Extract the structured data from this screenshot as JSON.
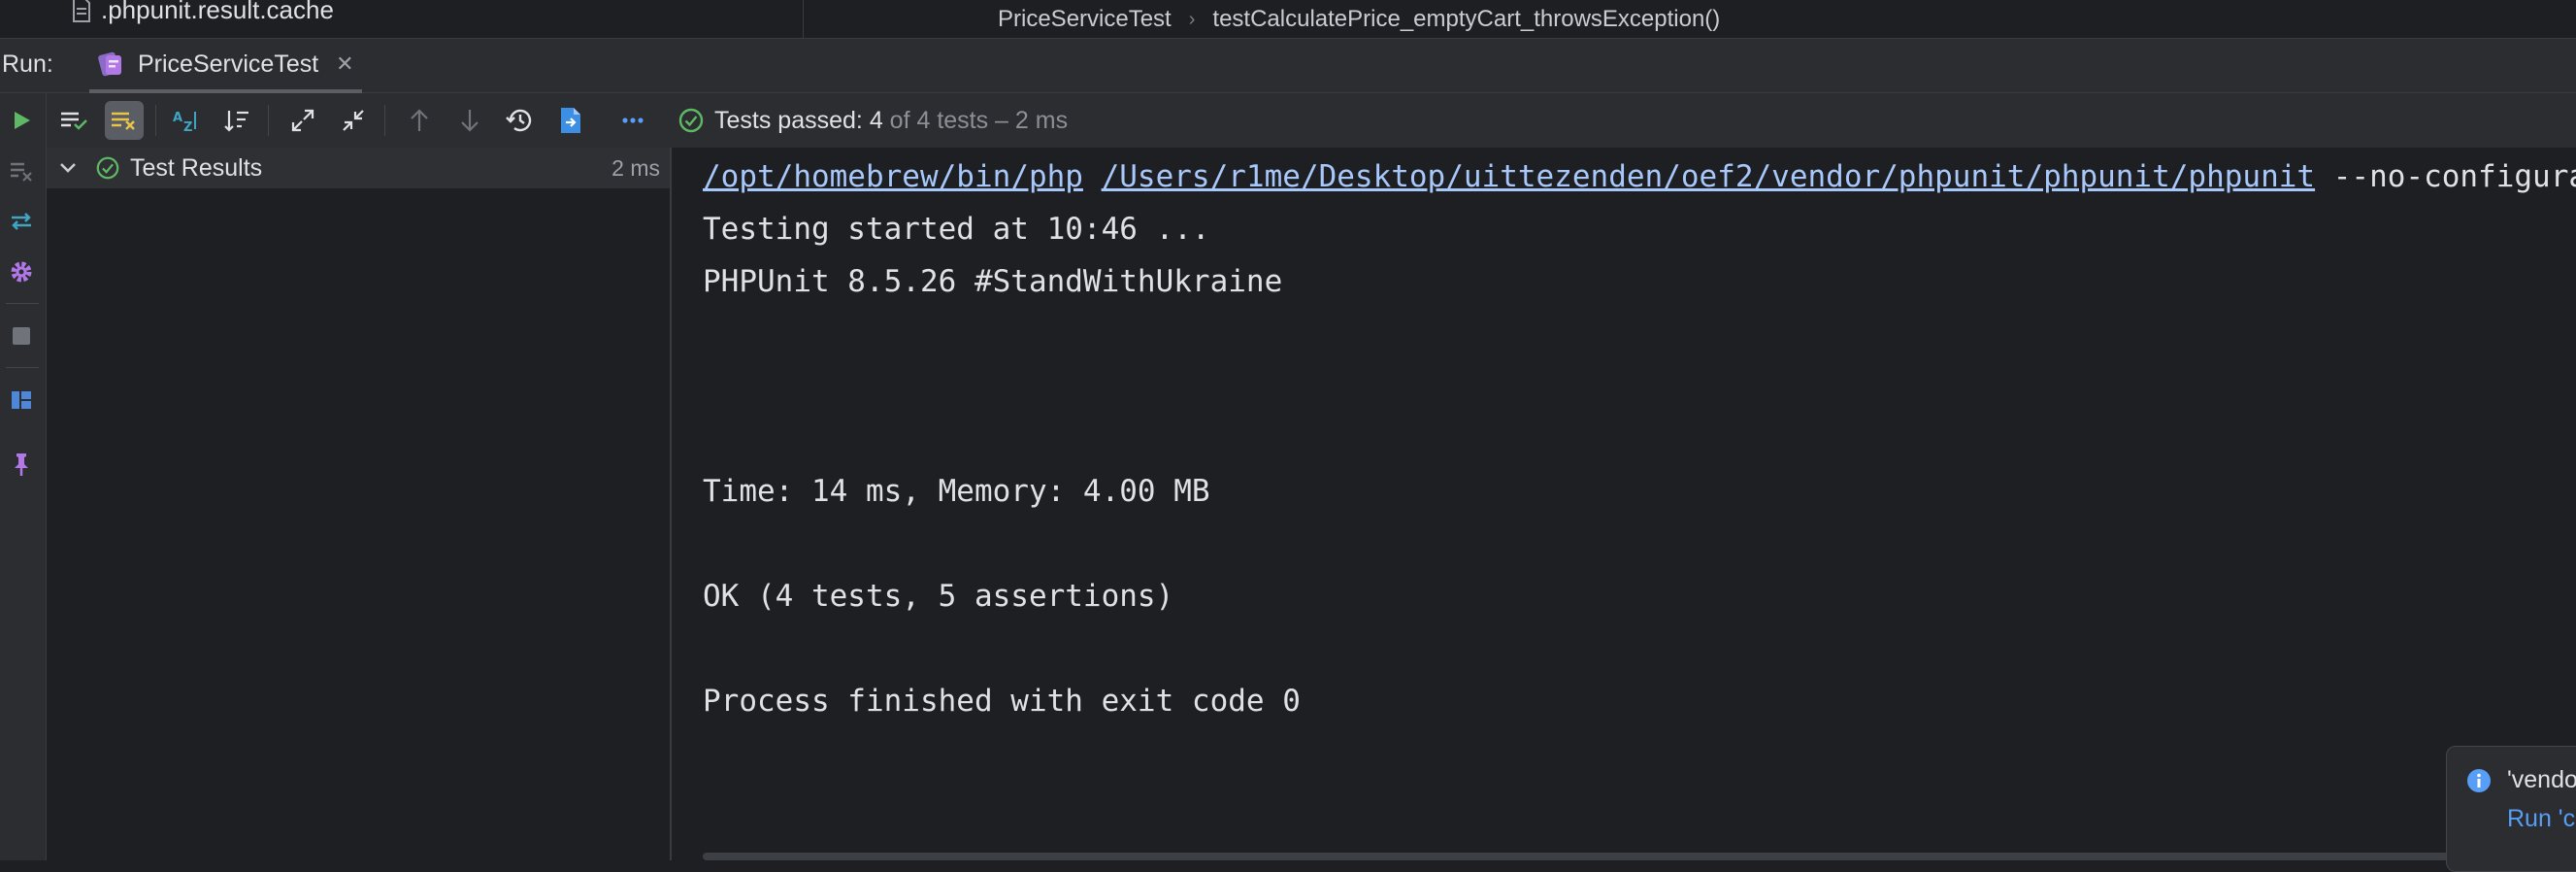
{
  "project": {
    "file_name": ".phpunit.result.cache"
  },
  "breadcrumb": {
    "class_name": "PriceServiceTest",
    "method_name": "testCalculatePrice_emptyCart_throwsException()"
  },
  "run_bar": {
    "label": "Run:",
    "tab_title": "PriceServiceTest"
  },
  "test_status": {
    "passed_label": "Tests passed:",
    "passed_count": "4",
    "of_total": "of 4 tests – 2 ms"
  },
  "tree": {
    "root_label": "Test Results",
    "root_duration": "2 ms"
  },
  "console": {
    "php_path": "/opt/homebrew/bin/php",
    "phpunit_path": "/Users/r1me/Desktop/uittezenden/oef2/vendor/phpunit/phpunit/phpunit",
    "args": "--no-configuration",
    "lines": {
      "started": "Testing started at 10:46 ...",
      "version": "PHPUnit 8.5.26 #StandWithUkraine",
      "time": "Time: 14 ms, Memory: 4.00 MB",
      "ok": "OK (4 tests, 5 assertions)",
      "finished": "Process finished with exit code 0"
    }
  },
  "notification": {
    "title": "'vendor",
    "action": "Run 'c"
  },
  "colors": {
    "success_green": "#5fb865",
    "link_blue": "#a8c7fa",
    "accent_blue": "#589df6",
    "purple_accent": "#b278e8",
    "run_green": "#5fb865"
  },
  "icons": {
    "file": "file-icon",
    "php_tab": "php-test-icon",
    "run": "play-icon",
    "show_passed": "show-passed-icon",
    "show_ignored": "show-ignored-icon",
    "sort_alpha": "sort-alphabetically-icon",
    "sort_duration": "sort-by-duration-icon",
    "expand": "expand-all-icon",
    "collapse": "collapse-all-icon",
    "prev_failed": "arrow-up-icon",
    "next_failed": "arrow-down-icon",
    "history": "history-icon",
    "export": "export-icon",
    "more": "more-icon",
    "check": "check-circle-icon",
    "info": "info-icon"
  }
}
